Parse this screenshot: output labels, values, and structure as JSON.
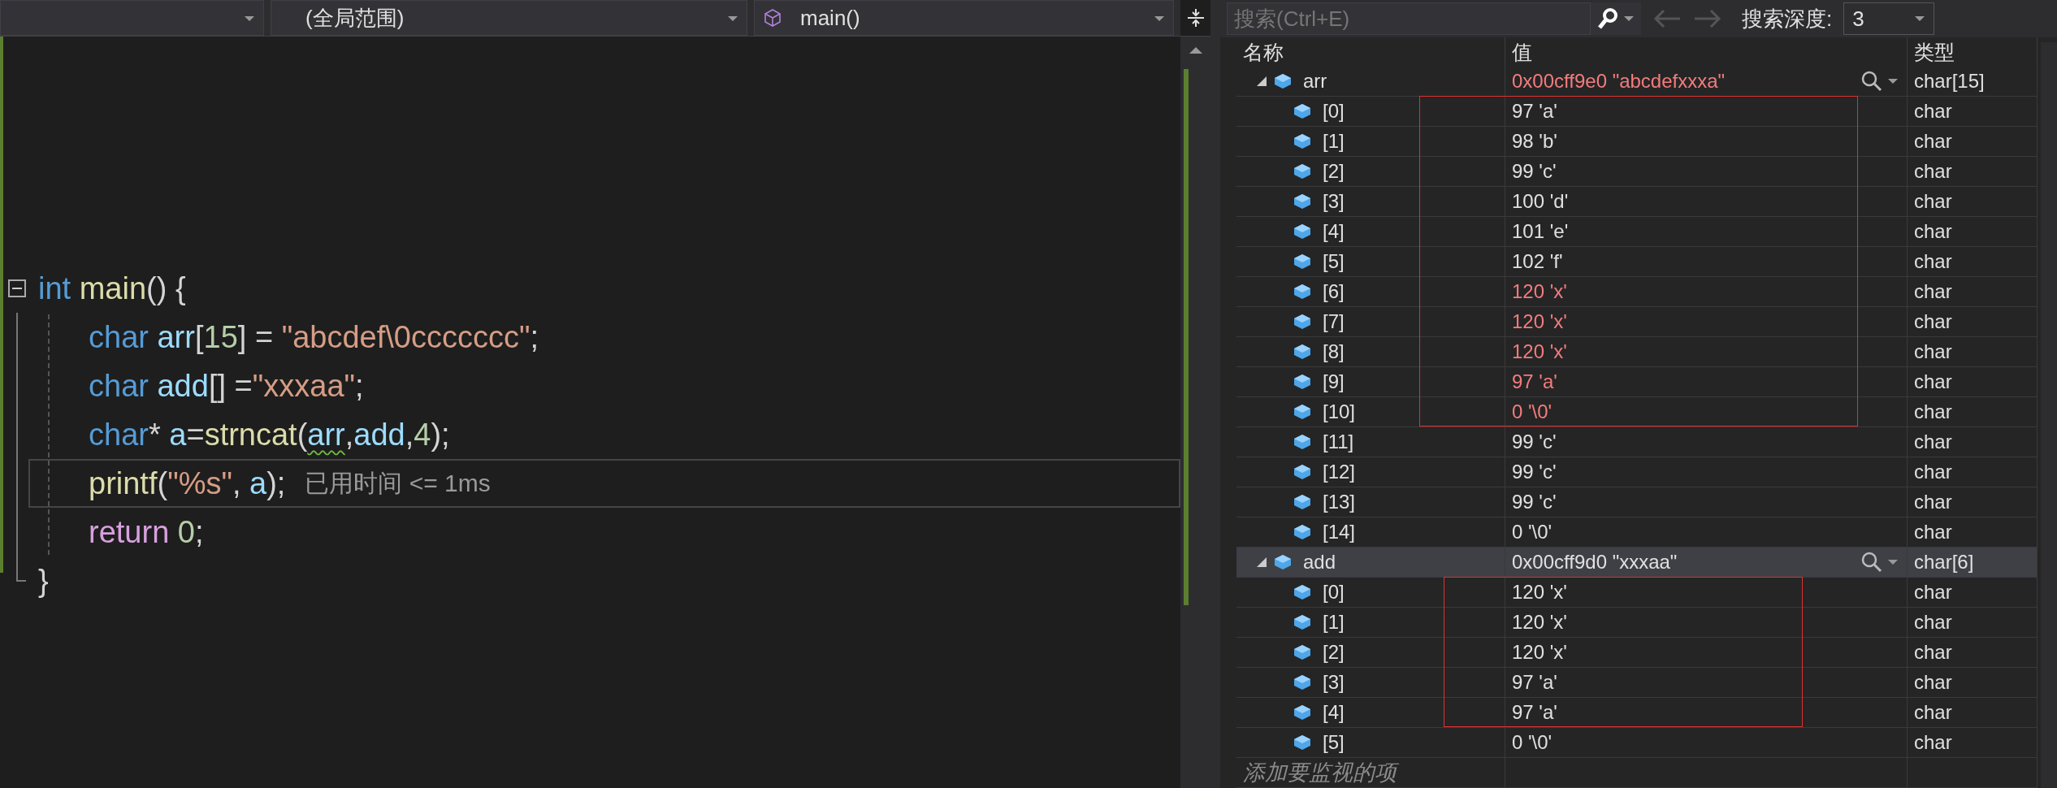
{
  "editor": {
    "dropdowns": [
      {
        "kind": "empty"
      },
      {
        "kind": "scope",
        "label": "(全局范围)"
      },
      {
        "kind": "function",
        "label": "main()"
      }
    ],
    "code": [
      {
        "tokens": [
          {
            "text": "int ",
            "kind": "keyword"
          },
          {
            "text": "main",
            "kind": "function"
          },
          {
            "text": "() {",
            "kind": "punct"
          }
        ],
        "current": false,
        "expanded": true,
        "children": [
          {
            "tokens": [
              {
                "text": "char ",
                "kind": "keyword"
              },
              {
                "text": "arr",
                "kind": "variable"
              },
              {
                "text": "[",
                "kind": "punct"
              },
              {
                "text": "15",
                "kind": "number"
              },
              {
                "text": "] = ",
                "kind": "punct"
              },
              {
                "text": "\"abcdef\\0ccccccc\"",
                "kind": "string"
              },
              {
                "text": ";",
                "kind": "punct"
              }
            ],
            "current": false
          },
          {
            "tokens": [
              {
                "text": "char ",
                "kind": "keyword"
              },
              {
                "text": "add",
                "kind": "variable"
              },
              {
                "text": "[] =",
                "kind": "punct"
              },
              {
                "text": "\"xxxaa\"",
                "kind": "string"
              },
              {
                "text": ";",
                "kind": "punct"
              }
            ],
            "current": false
          },
          {
            "tokens": [
              {
                "text": "char",
                "kind": "keyword"
              },
              {
                "text": "* ",
                "kind": "punct"
              },
              {
                "text": "a",
                "kind": "variable"
              },
              {
                "text": "=",
                "kind": "punct"
              },
              {
                "text": "strncat",
                "kind": "function"
              },
              {
                "text": "(",
                "kind": "punct"
              },
              {
                "text": "arr",
                "kind": "variable",
                "squiggle": true
              },
              {
                "text": ",",
                "kind": "punct"
              },
              {
                "text": "add",
                "kind": "variable"
              },
              {
                "text": ",",
                "kind": "punct"
              },
              {
                "text": "4",
                "kind": "number"
              },
              {
                "text": ");",
                "kind": "punct"
              }
            ],
            "current": false
          },
          {
            "tokens": [
              {
                "text": "printf",
                "kind": "function"
              },
              {
                "text": "(",
                "kind": "punct"
              },
              {
                "text": "\"%s\"",
                "kind": "string"
              },
              {
                "text": ", ",
                "kind": "punct"
              },
              {
                "text": "a",
                "kind": "variable"
              },
              {
                "text": ");",
                "kind": "punct"
              }
            ],
            "current": true,
            "hint": "已用时间 <= 1ms"
          },
          {
            "tokens": [
              {
                "text": "return ",
                "kind": "control"
              },
              {
                "text": "0",
                "kind": "number"
              },
              {
                "text": ";",
                "kind": "punct"
              }
            ],
            "current": false
          }
        ],
        "closing": [
          {
            "text": "}",
            "kind": "punct"
          }
        ]
      }
    ]
  },
  "watch": {
    "search": {
      "placeholder": "搜索(Ctrl+E)"
    },
    "depth_label": "搜索深度:",
    "depth_value": "3",
    "columns": [
      "名称",
      "值",
      "类型"
    ],
    "rows": [
      {
        "name": "arr",
        "value": "0x00cff9e0 \"abcdefxxxa\"",
        "type": "char[15]",
        "changed": true,
        "selected": false,
        "expanded": true,
        "children": [
          {
            "name": "[0]",
            "value": "97 'a'",
            "type": "char",
            "changed": false,
            "boxed": true
          },
          {
            "name": "[1]",
            "value": "98 'b'",
            "type": "char",
            "changed": false,
            "boxed": true
          },
          {
            "name": "[2]",
            "value": "99 'c'",
            "type": "char",
            "changed": false,
            "boxed": true
          },
          {
            "name": "[3]",
            "value": "100 'd'",
            "type": "char",
            "changed": false,
            "boxed": true
          },
          {
            "name": "[4]",
            "value": "101 'e'",
            "type": "char",
            "changed": false,
            "boxed": true
          },
          {
            "name": "[5]",
            "value": "102 'f'",
            "type": "char",
            "changed": false,
            "boxed": true
          },
          {
            "name": "[6]",
            "value": "120 'x'",
            "type": "char",
            "changed": true,
            "boxed": true
          },
          {
            "name": "[7]",
            "value": "120 'x'",
            "type": "char",
            "changed": true,
            "boxed": true
          },
          {
            "name": "[8]",
            "value": "120 'x'",
            "type": "char",
            "changed": true,
            "boxed": true
          },
          {
            "name": "[9]",
            "value": "97 'a'",
            "type": "char",
            "changed": true,
            "boxed": true
          },
          {
            "name": "[10]",
            "value": "0 '\\0'",
            "type": "char",
            "changed": true,
            "boxed": true
          },
          {
            "name": "[11]",
            "value": "99 'c'",
            "type": "char",
            "changed": false,
            "boxed": false
          },
          {
            "name": "[12]",
            "value": "99 'c'",
            "type": "char",
            "changed": false,
            "boxed": false
          },
          {
            "name": "[13]",
            "value": "99 'c'",
            "type": "char",
            "changed": false,
            "boxed": false
          },
          {
            "name": "[14]",
            "value": "0 '\\0'",
            "type": "char",
            "changed": false,
            "boxed": false
          }
        ]
      },
      {
        "name": "add",
        "value": "0x00cff9d0 \"xxxaa\"",
        "type": "char[6]",
        "changed": false,
        "selected": true,
        "expanded": true,
        "children": [
          {
            "name": "[0]",
            "value": "120 'x'",
            "type": "char",
            "changed": false,
            "boxed": true
          },
          {
            "name": "[1]",
            "value": "120 'x'",
            "type": "char",
            "changed": false,
            "boxed": true
          },
          {
            "name": "[2]",
            "value": "120 'x'",
            "type": "char",
            "changed": false,
            "boxed": true
          },
          {
            "name": "[3]",
            "value": "97 'a'",
            "type": "char",
            "changed": false,
            "boxed": true
          },
          {
            "name": "[4]",
            "value": "97 'a'",
            "type": "char",
            "changed": false,
            "boxed": true
          },
          {
            "name": "[5]",
            "value": "0 '\\0'",
            "type": "char",
            "changed": false,
            "boxed": false
          }
        ]
      }
    ],
    "add_placeholder": "添加要监视的项"
  }
}
